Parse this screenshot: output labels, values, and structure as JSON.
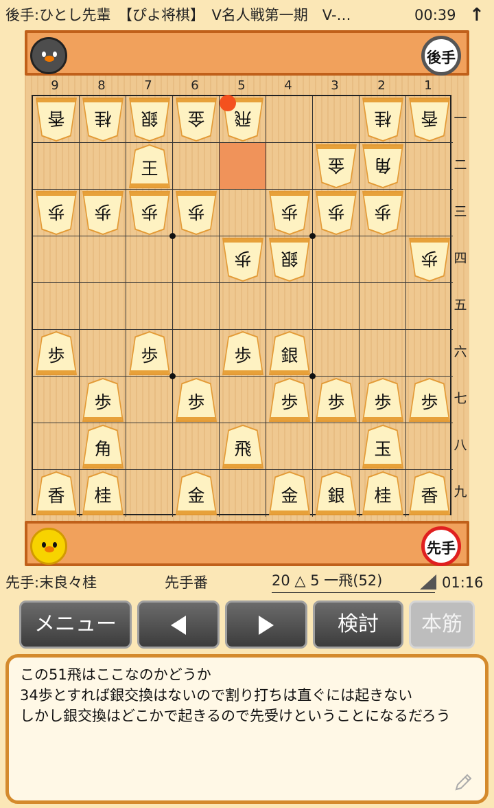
{
  "topbar": {
    "title": "後手:ひとし先輩　【ぴよ将棋】　V名人戦第一期　V-…",
    "clock": "00:39",
    "arrow": "↑"
  },
  "stands": {
    "gote_badge": "後手",
    "sente_badge": "先手"
  },
  "board": {
    "file_labels": [
      "9",
      "8",
      "7",
      "6",
      "5",
      "4",
      "3",
      "2",
      "1"
    ],
    "rank_labels": [
      "一",
      "二",
      "三",
      "四",
      "五",
      "六",
      "七",
      "八",
      "九"
    ],
    "highlight": {
      "file": 5,
      "rank": 2
    },
    "last_move_dot": {
      "file": 5,
      "rank": 1
    },
    "pieces": [
      {
        "file": 9,
        "rank": 1,
        "label": "香",
        "side": "gote"
      },
      {
        "file": 8,
        "rank": 1,
        "label": "桂",
        "side": "gote"
      },
      {
        "file": 7,
        "rank": 1,
        "label": "銀",
        "side": "gote"
      },
      {
        "file": 6,
        "rank": 1,
        "label": "金",
        "side": "gote"
      },
      {
        "file": 5,
        "rank": 1,
        "label": "飛",
        "side": "gote"
      },
      {
        "file": 2,
        "rank": 1,
        "label": "桂",
        "side": "gote"
      },
      {
        "file": 1,
        "rank": 1,
        "label": "香",
        "side": "gote"
      },
      {
        "file": 7,
        "rank": 2,
        "label": "王",
        "side": "sente"
      },
      {
        "file": 3,
        "rank": 2,
        "label": "金",
        "side": "gote"
      },
      {
        "file": 2,
        "rank": 2,
        "label": "角",
        "side": "gote"
      },
      {
        "file": 9,
        "rank": 3,
        "label": "歩",
        "side": "gote"
      },
      {
        "file": 8,
        "rank": 3,
        "label": "歩",
        "side": "gote"
      },
      {
        "file": 7,
        "rank": 3,
        "label": "歩",
        "side": "gote"
      },
      {
        "file": 6,
        "rank": 3,
        "label": "歩",
        "side": "gote"
      },
      {
        "file": 4,
        "rank": 3,
        "label": "歩",
        "side": "gote"
      },
      {
        "file": 3,
        "rank": 3,
        "label": "歩",
        "side": "gote"
      },
      {
        "file": 2,
        "rank": 3,
        "label": "歩",
        "side": "gote"
      },
      {
        "file": 5,
        "rank": 4,
        "label": "歩",
        "side": "gote"
      },
      {
        "file": 4,
        "rank": 4,
        "label": "銀",
        "side": "gote"
      },
      {
        "file": 1,
        "rank": 4,
        "label": "歩",
        "side": "gote"
      },
      {
        "file": 9,
        "rank": 6,
        "label": "歩",
        "side": "sente"
      },
      {
        "file": 7,
        "rank": 6,
        "label": "歩",
        "side": "sente"
      },
      {
        "file": 5,
        "rank": 6,
        "label": "歩",
        "side": "sente"
      },
      {
        "file": 4,
        "rank": 6,
        "label": "銀",
        "side": "sente"
      },
      {
        "file": 8,
        "rank": 7,
        "label": "歩",
        "side": "sente"
      },
      {
        "file": 6,
        "rank": 7,
        "label": "歩",
        "side": "sente"
      },
      {
        "file": 4,
        "rank": 7,
        "label": "歩",
        "side": "sente"
      },
      {
        "file": 3,
        "rank": 7,
        "label": "歩",
        "side": "sente"
      },
      {
        "file": 2,
        "rank": 7,
        "label": "歩",
        "side": "sente"
      },
      {
        "file": 1,
        "rank": 7,
        "label": "歩",
        "side": "sente"
      },
      {
        "file": 8,
        "rank": 8,
        "label": "角",
        "side": "sente"
      },
      {
        "file": 5,
        "rank": 8,
        "label": "飛",
        "side": "sente"
      },
      {
        "file": 2,
        "rank": 8,
        "label": "玉",
        "side": "sente"
      },
      {
        "file": 9,
        "rank": 9,
        "label": "香",
        "side": "sente"
      },
      {
        "file": 8,
        "rank": 9,
        "label": "桂",
        "side": "sente"
      },
      {
        "file": 6,
        "rank": 9,
        "label": "金",
        "side": "sente"
      },
      {
        "file": 4,
        "rank": 9,
        "label": "金",
        "side": "sente"
      },
      {
        "file": 3,
        "rank": 9,
        "label": "銀",
        "side": "sente"
      },
      {
        "file": 2,
        "rank": 9,
        "label": "桂",
        "side": "sente"
      },
      {
        "file": 1,
        "rank": 9,
        "label": "香",
        "side": "sente"
      }
    ]
  },
  "info": {
    "sente_player": "先手:末良々桂",
    "turn": "先手番",
    "move": "20 △ 5 一飛(52)",
    "time": "01:16"
  },
  "buttons": {
    "menu": "メニュー",
    "review": "検討",
    "mainline": "本筋"
  },
  "comment": {
    "text": "この51飛はここなのかどうか\n34歩とすれば銀交換はないので割り打ちは直ぐには起きない\nしかし銀交換はどこかで起きるので先受けということになるだろう"
  },
  "colors": {
    "board": "#efc890",
    "stand": "#f1a15c",
    "accent_dot": "#f4511e"
  }
}
